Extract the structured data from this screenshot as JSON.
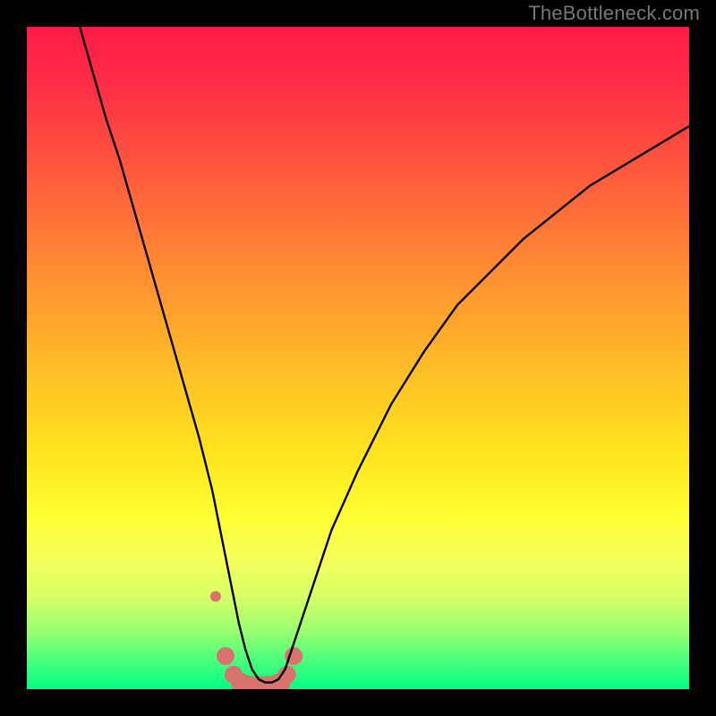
{
  "watermark": {
    "text": "TheBottleneck.com"
  },
  "colors": {
    "background": "#000000",
    "curve_stroke": "#000000",
    "marker_fill": "#d9736e",
    "gradient_stops": [
      "#ff1b47",
      "#ff2b45",
      "#ff5a3d",
      "#ff8a33",
      "#ffb828",
      "#ffe31d",
      "#ffff33",
      "#f7ff5a",
      "#d6ff66",
      "#9cff70",
      "#55ff7a",
      "#00ff84"
    ]
  },
  "chart_data": {
    "type": "line",
    "title": "",
    "xlabel": "",
    "ylabel": "",
    "xlim": [
      0,
      100
    ],
    "ylim": [
      0,
      100
    ],
    "series": [
      {
        "name": "bottleneck-curve",
        "x": [
          8,
          10,
          12,
          14,
          16,
          18,
          20,
          22,
          24,
          26,
          28,
          29,
          30,
          31,
          32,
          33,
          34,
          35,
          36,
          37,
          38,
          39,
          40,
          42,
          44,
          46,
          50,
          55,
          60,
          65,
          70,
          75,
          80,
          85,
          90,
          95,
          100
        ],
        "values": [
          100,
          93,
          86,
          80,
          73,
          66,
          59,
          52,
          45,
          38,
          30,
          25,
          20,
          15,
          10,
          6,
          3,
          1.5,
          1,
          1,
          1.5,
          3,
          6,
          12,
          18,
          24,
          33,
          43,
          51,
          58,
          63,
          68,
          72,
          76,
          79,
          82,
          85
        ]
      }
    ],
    "markers": {
      "name": "highlight-band",
      "x": [
        28.5,
        30.0,
        31.2,
        32.3,
        33.3,
        34.3,
        35.3,
        36.3,
        37.3,
        38.3,
        39.3,
        40.3
      ],
      "values": [
        14.0,
        5.0,
        2.2,
        1.0,
        0.6,
        0.5,
        0.5,
        0.5,
        0.6,
        1.0,
        2.2,
        5.0
      ],
      "radius": [
        6,
        10,
        10,
        11,
        11,
        11,
        11,
        11,
        11,
        11,
        10,
        10
      ]
    }
  }
}
